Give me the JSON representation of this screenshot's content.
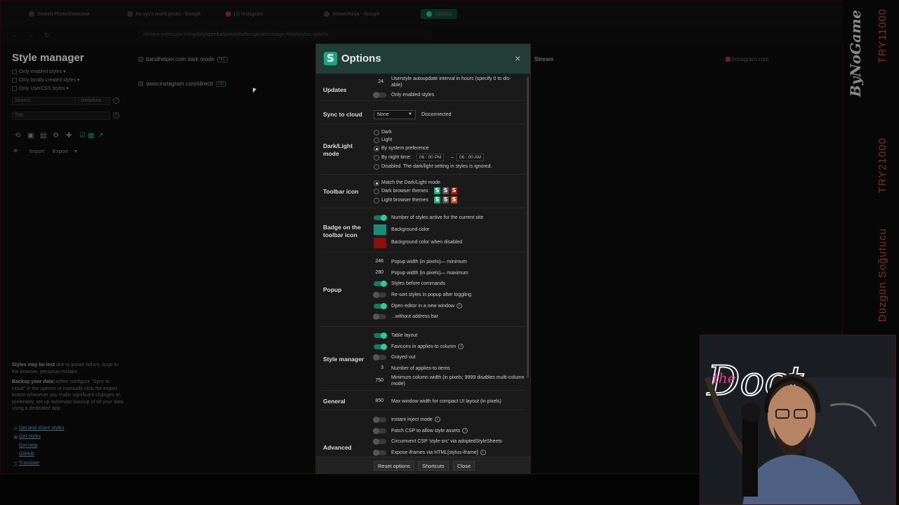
{
  "browser": {
    "tabs": [
      {
        "label": "Search PhotoShowcase"
      },
      {
        "label": "An xyx's world photo - Google"
      },
      {
        "label": "(1) Instagram"
      },
      {
        "label": "StreamNinja - Google"
      },
      {
        "label": "Options"
      }
    ],
    "url": "chrome-extension://clngdbkpkpeebahjckkjfobafhncgmne/manage.html#stylus-options"
  },
  "sidebar": {
    "title": "Style manager",
    "filters": [
      "Only enabled styles ▾",
      "Only locally created styles ▾",
      "Only UserCSS styles ▾"
    ],
    "search_placeholder": "Search",
    "search_mode": "Metadata",
    "sort": "Title",
    "import_label": "Import",
    "export_label": "Export",
    "warning_bold": "Styles may be lost",
    "warning_rest": " due to power failure, bugs in the browser, personal mistake.",
    "backup_bold": "Backup your data:",
    "backup_rest": " either configure \"Sync to cloud\" in the options or manually click the export button whenever you make significant changes or, preferably, set up automatic backup of all your data using a dedicated app.",
    "links": [
      "Get and share styles",
      "Get styles",
      "Get help",
      "GitHub",
      "Translate"
    ]
  },
  "style_list": {
    "entries": [
      {
        "name": "bandhelper.com dark mode",
        "badge": "UC"
      },
      {
        "name": "www.instagram.com/direct/",
        "badge": "UC"
      }
    ],
    "bg_stream": "Stream",
    "bg_instagram": "instagram.com"
  },
  "options": {
    "title": "Options",
    "close_icon": "×",
    "updates": {
      "label": "Updates",
      "interval_value": "24",
      "interval_text": "Userstyle autoupdate interval in hours (specify 0 to dis-able)",
      "only_enabled": "Only enabled styles"
    },
    "sync": {
      "label": "Sync to cloud",
      "selected": "None",
      "status": "Disconnected"
    },
    "dark_light": {
      "label": "Dark/Light mode",
      "dark": "Dark",
      "light": "Light",
      "system": "By system preference",
      "night": "By night time:",
      "night_start": "06 : 00  PM",
      "night_dash": "–",
      "night_end": "06 : 00  AM",
      "disabled": "Disabled. The dark/light setting in styles is ignored."
    },
    "toolbar_icon": {
      "label": "Toolbar icon",
      "match": "Match the Dark/Light mode",
      "dark_themes": "Dark browser themes",
      "light_themes": "Light browser themes",
      "s_glyph": "S"
    },
    "badge": {
      "label": "Badge on the toolbar icon",
      "count": "Number of styles active for the current site",
      "bg": "Background color",
      "bg_disabled": "Background color when disabled",
      "bg_color": "#1a8f78",
      "bg_disabled_color": "#8b0f0f"
    },
    "popup": {
      "label": "Popup",
      "min_value": "246",
      "min_text": "Popup width (in pixels)— minimum",
      "max_value": "280",
      "max_text": "Popup width (in pixels)— maximum",
      "styles_before": "Styles before commands",
      "resort": "Re-sort styles in popup after toggling",
      "open_editor": "Open editor in a new window",
      "without_address": "...without address bar"
    },
    "style_manager": {
      "label": "Style manager",
      "table_layout": "Table layout",
      "favicons": "Favicons in applies-to column",
      "grayed_out": "Grayed out",
      "applies_value": "3",
      "applies_text": "Number of applies-to items",
      "min_col_value": "750",
      "min_col_text": "Minimum column width (in pixels; 9999 disables multi-column mode)"
    },
    "general": {
      "label": "General",
      "max_width_value": "850",
      "max_width_text": "Max window width for compact UI layout (in pixels)"
    },
    "advanced": {
      "label": "Advanced",
      "instant_inject": "Instant inject mode",
      "patch_csp": "Patch CSP to allow style assets",
      "circumvent": "Circumvent CSP 'style-src' via adoptedStyleSheets",
      "expose_iframes": "Expose iframes via HTML[stylus-iframe]"
    },
    "footer": {
      "reset": "Reset options",
      "shortcuts": "Shortcuts",
      "close": "Close"
    },
    "info_glyph": "i"
  },
  "overlay": {
    "brand": "ByNoGame",
    "codes": [
      "TRY11000",
      "TRY21000",
      "Düzgün Soğutucu"
    ]
  },
  "colors": {
    "accent": "#1ca683",
    "header": "#213d36",
    "danger": "#8b0f0f"
  }
}
